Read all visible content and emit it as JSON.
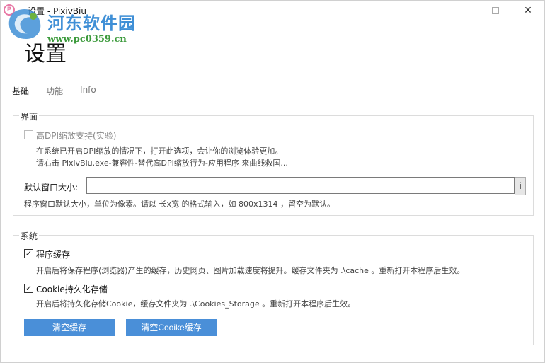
{
  "window": {
    "title": "设置 - PixivBiu",
    "app_icon": "pixivbiu-icon"
  },
  "watermark": {
    "text": "河东软件园",
    "url": "www.pc0359.cn"
  },
  "page": {
    "title": "设置"
  },
  "tabs": [
    {
      "label": "基础",
      "active": true
    },
    {
      "label": "功能",
      "active": false
    },
    {
      "label": "Info",
      "active": false
    }
  ],
  "ui_group": {
    "legend": "界面",
    "hidpi_label": "高DPI缩放支持(实验)",
    "hidpi_checked": false,
    "hidpi_desc_1": "在系统已开启DPI缩放的情况下，打开此选项，会让你的浏览体验更加。",
    "hidpi_desc_2": "请右击 PixivBiu.exe-兼容性-替代高DPI缩放行为-应用程序 来曲线救国...",
    "window_size_label": "默认窗口大小:",
    "window_size_value": "",
    "info_button": "i",
    "window_size_desc": "程序窗口默认大小，单位为像素。请以 长x宽 的格式输入，如 800x1314 ，留空为默认。"
  },
  "system_group": {
    "legend": "系统",
    "cache_label": "程序缓存",
    "cache_checked": true,
    "cache_desc": "开启后将保存程序(浏览器)产生的缓存，历史网页、图片加载速度将提升。缓存文件夹为 .\\cache 。重新打开本程序后生效。",
    "cookie_label": "Cookie持久化存储",
    "cookie_checked": true,
    "cookie_desc": "开启后将持久化存储Cookie，缓存文件夹为 .\\Cookies_Storage 。重新打开本程序后生效。",
    "clear_cache_button": "清空缓存",
    "clear_cookie_button": "清空Cooike缓存"
  },
  "colors": {
    "accent": "#4a8fd8",
    "watermark_blue": "#3f8fd6",
    "watermark_green": "#3c9a3c"
  }
}
